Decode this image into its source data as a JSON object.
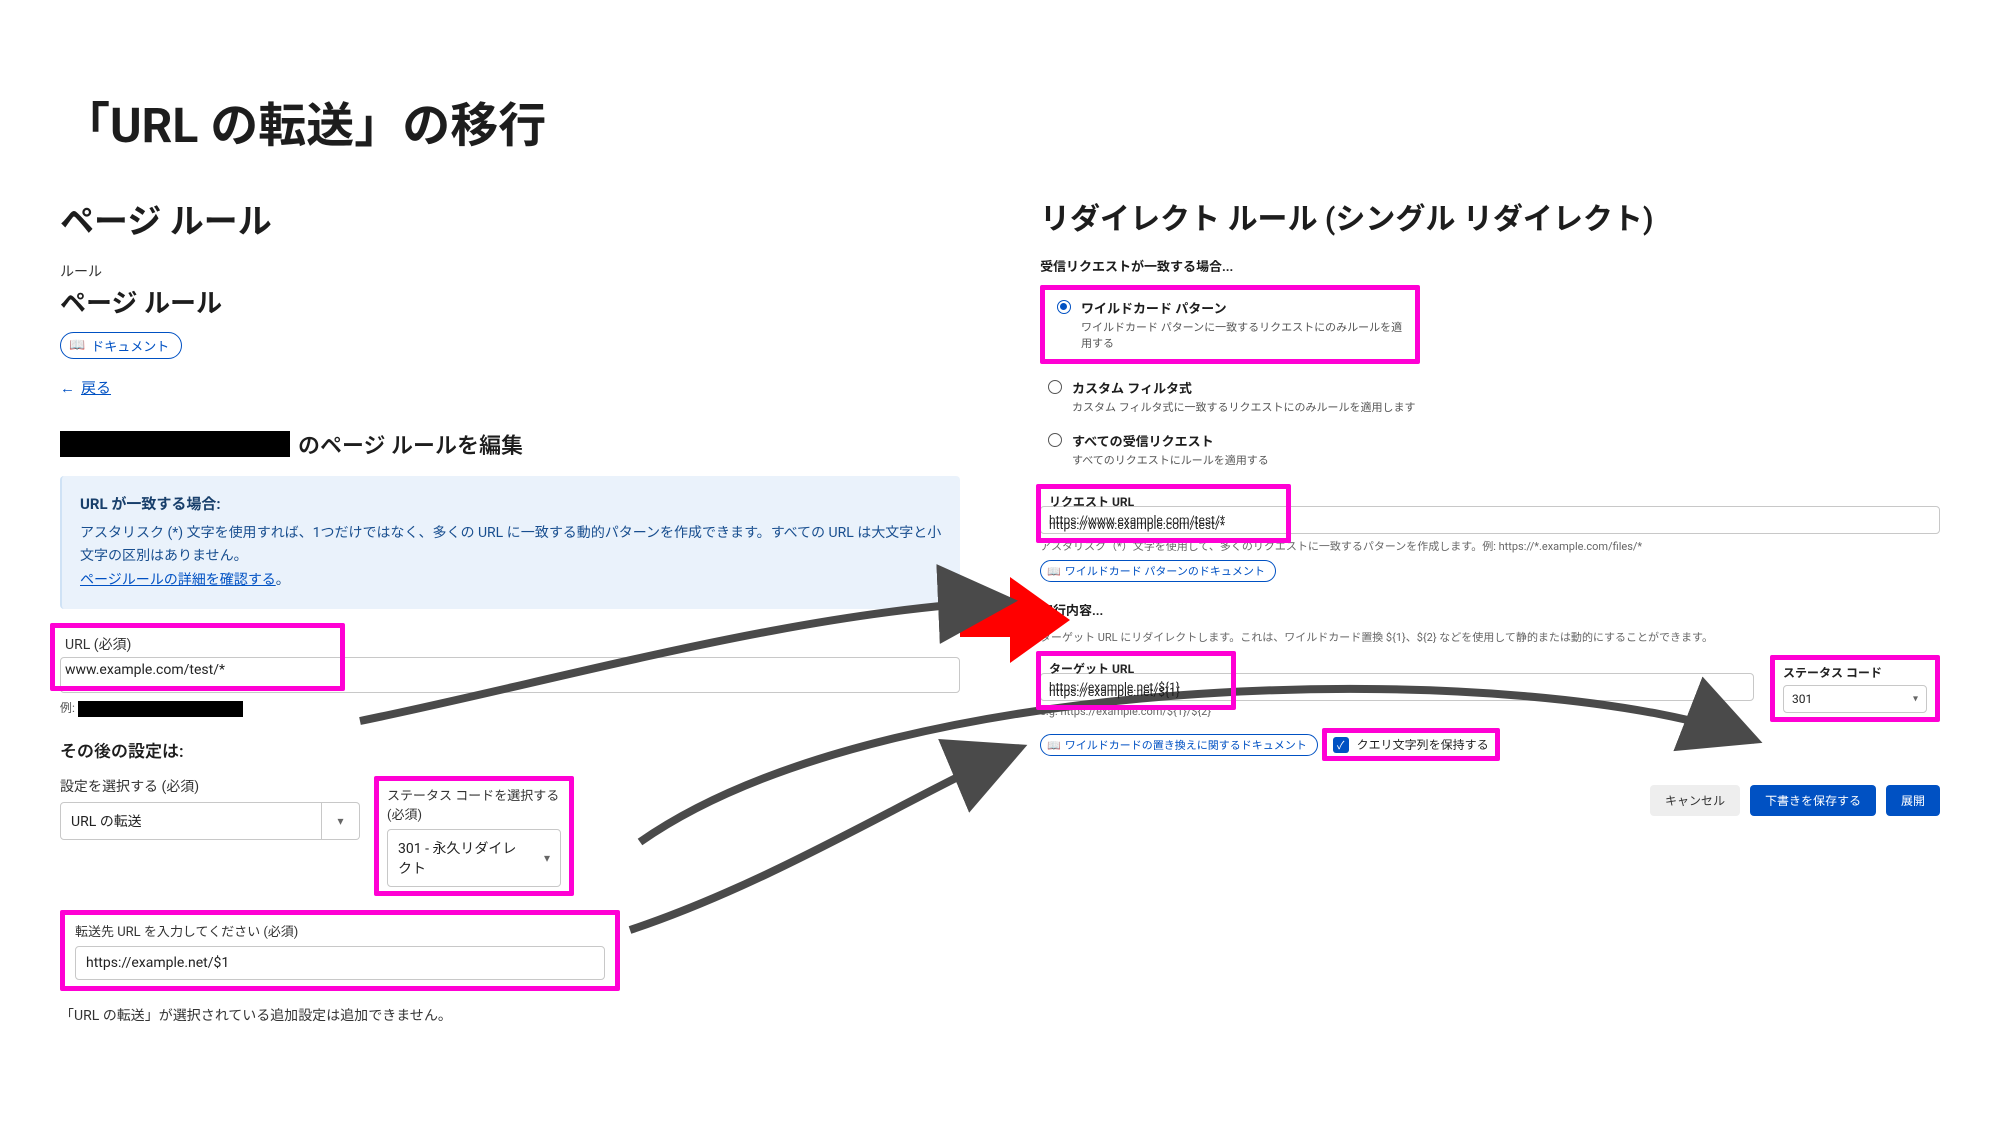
{
  "slide_title": "「URL の転送」の移行",
  "left": {
    "heading": "ページ ルール",
    "breadcrumb_label": "ルール",
    "subheading": "ページ ルール",
    "doc_badge": "ドキュメント",
    "back": "戻る",
    "edit_suffix": "のページ ルールを編集",
    "info": {
      "title": "URL が一致する場合:",
      "body": "アスタリスク (*) 文字を使用すれば、1つだけではなく、多くの URL に一致する動的パターンを作成できます。すべての URL は大文字と小文字の区別はありません。",
      "link": "ページルールの詳細を確認する",
      "link_suffix": "。"
    },
    "url_label": "URL (必須)",
    "url_value": "www.example.com/test/*",
    "example_prefix": "例:",
    "after_heading": "その後の設定は:",
    "setting_label": "設定を選択する (必須)",
    "setting_value": "URL の転送",
    "status_label": "ステータス コードを選択する (必須)",
    "status_value": "301 - 永久リダイレクト",
    "dest_label": "転送先 URL を入力してください (必須)",
    "dest_value": "https://example.net/$1",
    "footer": "「URL の転送」が選択されている追加設定は追加できません。"
  },
  "right": {
    "heading": "リダイレクト ルール (シングル リダイレクト)",
    "match_heading": "受信リクエストが一致する場合...",
    "radios": [
      {
        "title": "ワイルドカード パターン",
        "desc": "ワイルドカード パターンに一致するリクエストにのみルールを適用する",
        "checked": true
      },
      {
        "title": "カスタム フィルタ式",
        "desc": "カスタム フィルタ式に一致するリクエストにのみルールを適用します",
        "checked": false
      },
      {
        "title": "すべての受信リクエスト",
        "desc": "すべてのリクエストにルールを適用する",
        "checked": false
      }
    ],
    "req_url_label": "リクエスト URL",
    "req_url_value": "https://www.example.com/test/*",
    "req_url_hint": "アスタリスク（*）文字を使用して、多くのリクエストに一致するパターンを作成します。例: https://*.example.com/files/*",
    "req_doc": "ワイルドカード パターンのドキュメント",
    "exec_heading": "実行内容...",
    "exec_desc": "ターゲット URL にリダイレクトします。これは、ワイルドカード置換 ${1}、${2} などを使用して静的または動的にすることができます。",
    "target_label": "ターゲット URL",
    "target_value": "https://example.net/${1}",
    "target_hint": "e.g. https://example.com/${1}/${2}",
    "target_doc": "ワイルドカードの置き換えに関するドキュメント",
    "status_label": "ステータス コード",
    "status_value": "301",
    "preserve_query": "クエリ文字列を保持する",
    "buttons": {
      "cancel": "キャンセル",
      "save_draft": "下書きを保存する",
      "deploy": "展開"
    }
  }
}
